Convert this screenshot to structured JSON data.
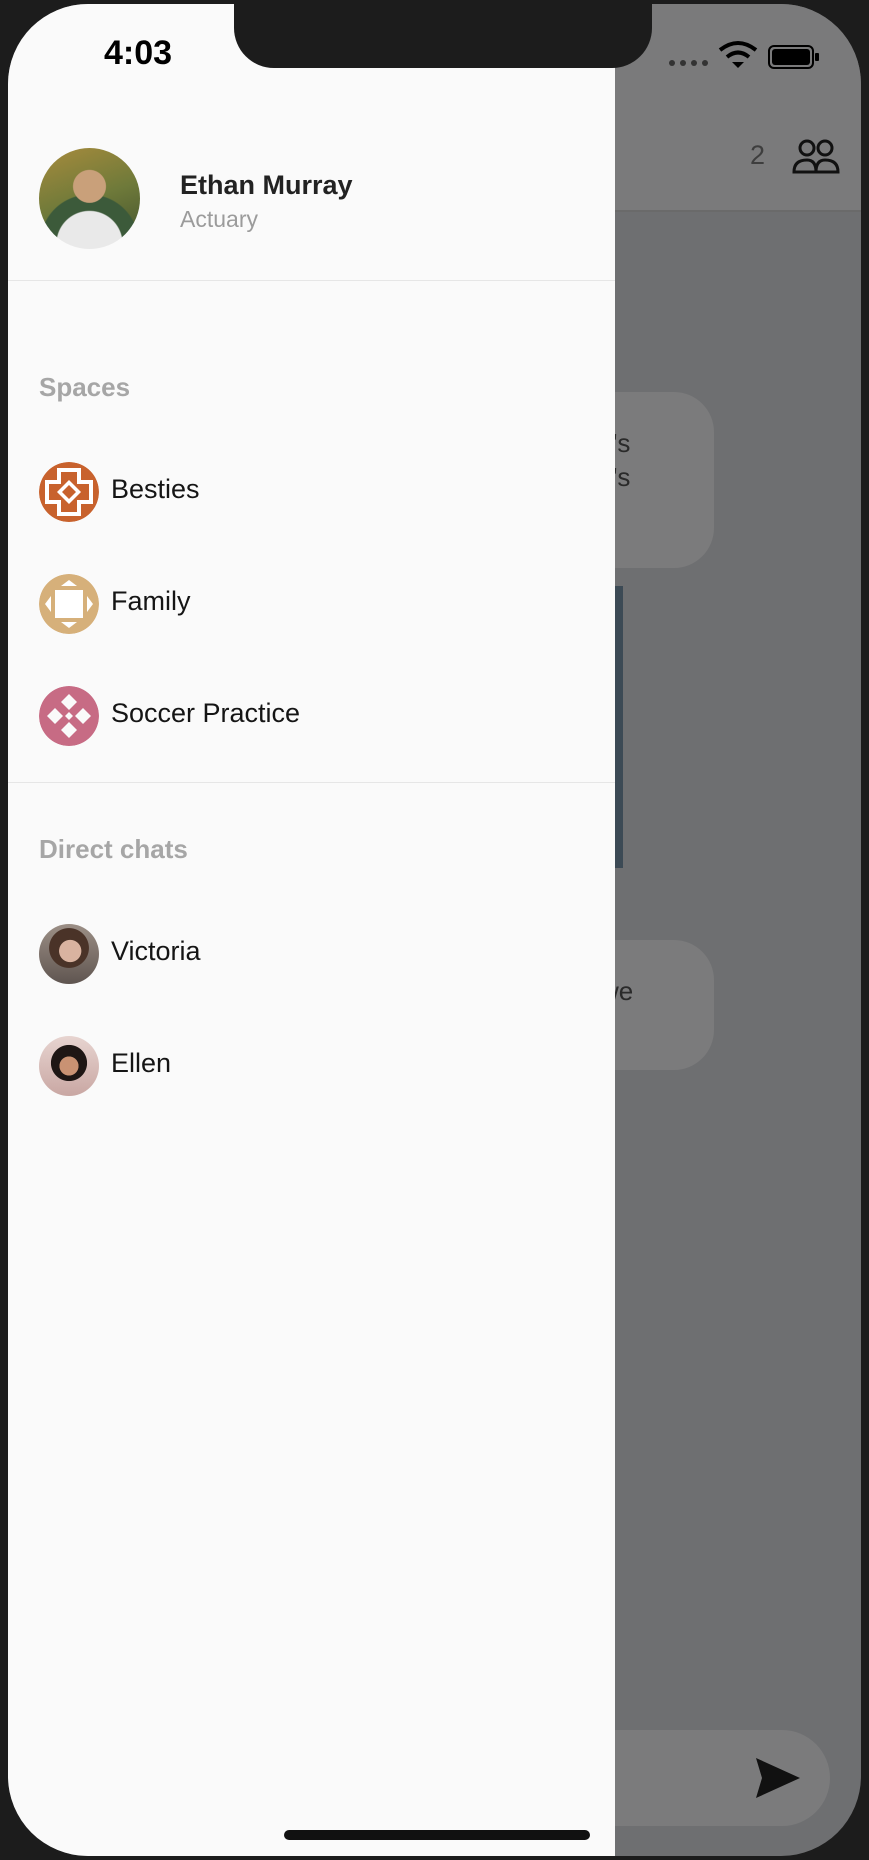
{
  "status_bar": {
    "time": "4:03"
  },
  "background_chat": {
    "member_count": "2",
    "bubble1_lines": [
      "o's",
      "o's"
    ],
    "bubble2_text": "we"
  },
  "drawer": {
    "profile": {
      "name": "Ethan Murray",
      "role": "Actuary"
    },
    "spaces": {
      "title": "Spaces",
      "items": [
        {
          "label": "Besties",
          "icon": "besties-space-icon",
          "color": "#c8622d"
        },
        {
          "label": "Family",
          "icon": "family-space-icon",
          "color": "#d6b07a"
        },
        {
          "label": "Soccer Practice",
          "icon": "soccer-space-icon",
          "color": "#c76b84"
        }
      ]
    },
    "direct_chats": {
      "title": "Direct chats",
      "items": [
        {
          "label": "Victoria",
          "icon": "victoria-avatar"
        },
        {
          "label": "Ellen",
          "icon": "ellen-avatar"
        }
      ]
    }
  }
}
